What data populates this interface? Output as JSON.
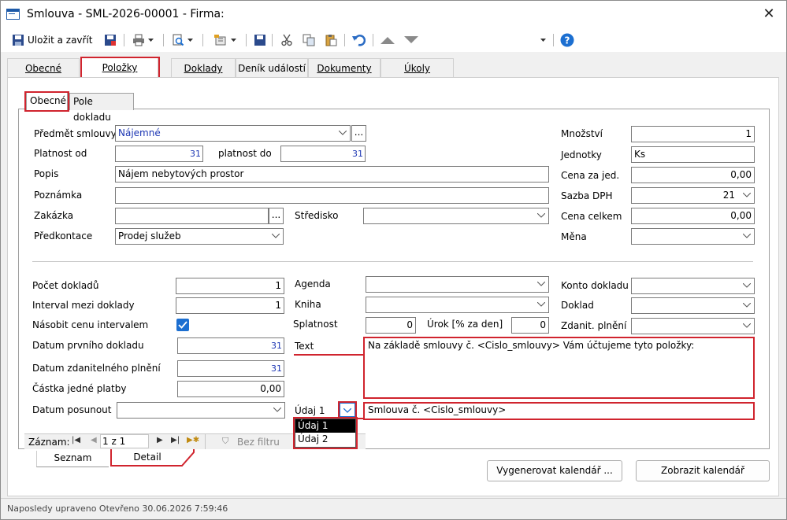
{
  "window": {
    "title": "Smlouva - SML-2026-00001 - Firma:",
    "close": "✕"
  },
  "toolbar": {
    "save_close": "Uložit a zavřít"
  },
  "tabs": [
    "Obecné",
    "Položky",
    "Doklady",
    "Deník událostí",
    "Dokumenty",
    "Úkoly"
  ],
  "subtabs": [
    "Obecné",
    "Pole dokladu"
  ],
  "form": {
    "predmet_label": "Předmět smlouvy",
    "predmet_value": "Nájemné",
    "platnost_od_label": "Platnost od",
    "platnost_do_label": "platnost do",
    "cal_glyph": "31",
    "popis_label": "Popis",
    "popis_value": "Nájem nebytových prostor",
    "poznamka_label": "Poznámka",
    "zakazka_label": "Zakázka",
    "stredisko_label": "Středisko",
    "predkontace_label": "Předkontace",
    "predkontace_value": "Prodej služeb",
    "mnozstvi_label": "Množství",
    "mnozstvi_value": "1",
    "jednotky_label": "Jednotky",
    "jednotky_value": "Ks",
    "cena_jed_label": "Cena za jed.",
    "cena_jed_value": "0,00",
    "sazba_label": "Sazba DPH",
    "sazba_value": "21",
    "cena_celkem_label": "Cena celkem",
    "cena_celkem_value": "0,00",
    "mena_label": "Měna",
    "pocet_label": "Počet dokladů",
    "pocet_value": "1",
    "interval_label": "Interval mezi doklady",
    "interval_value": "1",
    "nasobit_label": "Násobit cenu intervalem",
    "datum_prvniho_label": "Datum prvního dokladu",
    "datum_zdan_label": "Datum zdanitelného plnění",
    "castka_label": "Částka jedné platby",
    "castka_value": "0,00",
    "datum_posunout_label": "Datum posunout",
    "agenda_label": "Agenda",
    "kniha_label": "Kniha",
    "splatnost_label": "Splatnost",
    "splatnost_value": "0",
    "urok_label": "Úrok [% za den]",
    "urok_value": "0",
    "text_label": "Text",
    "text_value": "Na základě smlouvy č. <Cislo_smlouvy> Vám účtujeme tyto položky:",
    "udaj_label": "Údaj 1",
    "udaj_value": "Smlouva č. <Cislo_smlouvy>",
    "udaj_options": [
      "Údaj 1",
      "Údaj 2"
    ],
    "konto_label": "Konto dokladu",
    "doklad_label": "Doklad",
    "zdanit_label": "Zdanit. plnění"
  },
  "nav": {
    "zaznam_label": "Záznam:",
    "position": "1 z 1",
    "filter": "Bez filtru"
  },
  "bottom_tabs": [
    "Seznam",
    "Detail"
  ],
  "buttons": {
    "generate": "Vygenerovat kalendář ...",
    "show": "Zobrazit kalendář"
  },
  "status": {
    "text": "Naposledy upraveno   Otevřeno 30.06.2026 7:59:46"
  }
}
